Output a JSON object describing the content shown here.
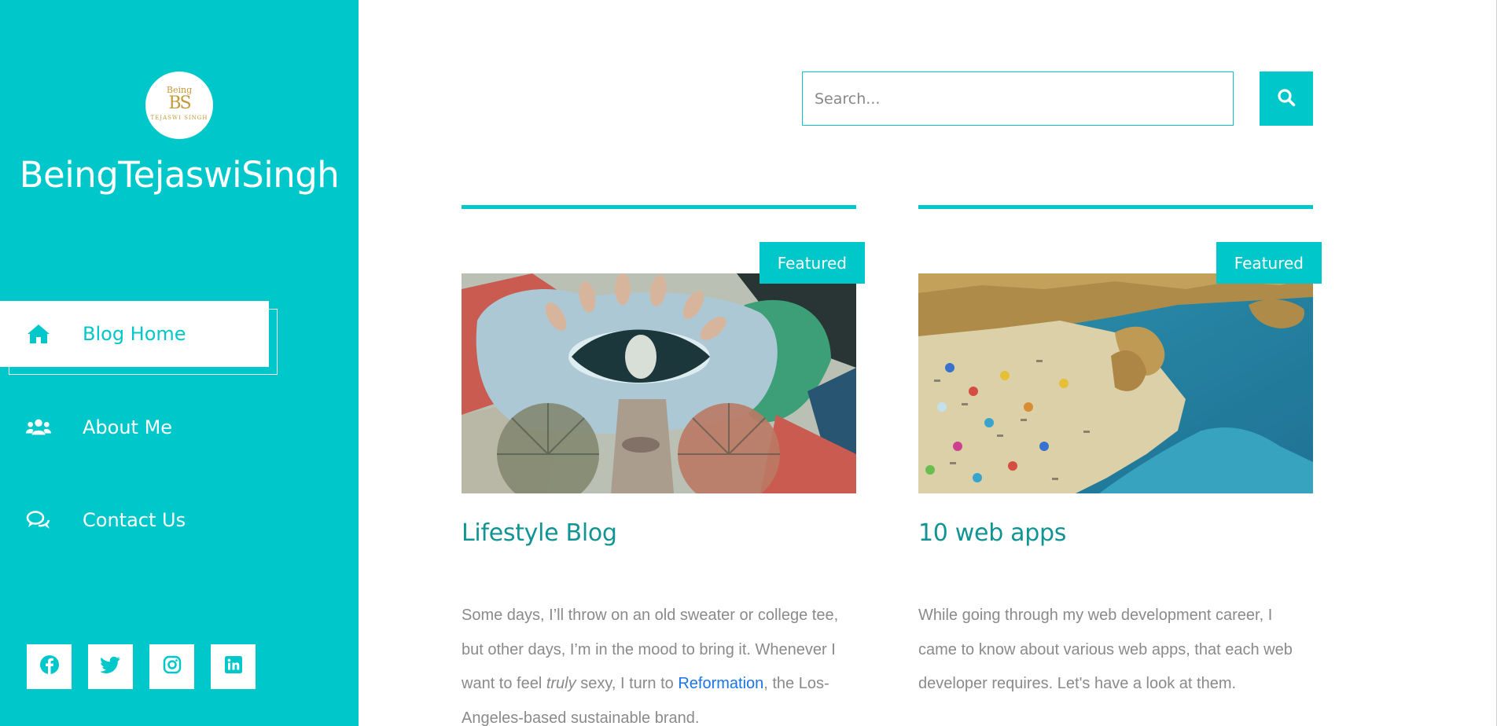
{
  "site": {
    "title": "BeingTejaswiSingh",
    "logo": {
      "top_text": "Being",
      "monogram": "BS",
      "bottom_text": "TEJASWI SINGH"
    }
  },
  "sidebar": {
    "items": [
      {
        "label": "Blog Home",
        "icon": "home-icon",
        "active": true
      },
      {
        "label": "About Me",
        "icon": "users-icon",
        "active": false
      },
      {
        "label": "Contact Us",
        "icon": "chat-icon",
        "active": false
      }
    ],
    "socials": [
      {
        "icon": "facebook-icon"
      },
      {
        "icon": "twitter-icon"
      },
      {
        "icon": "instagram-icon"
      },
      {
        "icon": "linkedin-icon"
      }
    ]
  },
  "search": {
    "placeholder": "Search...",
    "button_icon": "search-icon"
  },
  "posts": [
    {
      "badge": "Featured",
      "title": "Lifestyle Blog",
      "excerpt": {
        "part1": "Some days, I’ll throw on an old sweater or college tee, but other days, I’m in the mood to bring it. Whenever I want to feel ",
        "em": "truly",
        "part2": " sexy, I turn to ",
        "link": "Reformation",
        "part3": ", the Los-Angeles-based sustainable brand."
      }
    },
    {
      "badge": "Featured",
      "title": "10 web apps",
      "excerpt": {
        "part1": "While going through my web development career, I came to know about various web apps, that each web developer requires. Let's have a look at them."
      }
    }
  ],
  "colors": {
    "accent": "#00c7c9",
    "title": "#119493",
    "text": "#8a8a8a",
    "link": "#1a73e8"
  }
}
